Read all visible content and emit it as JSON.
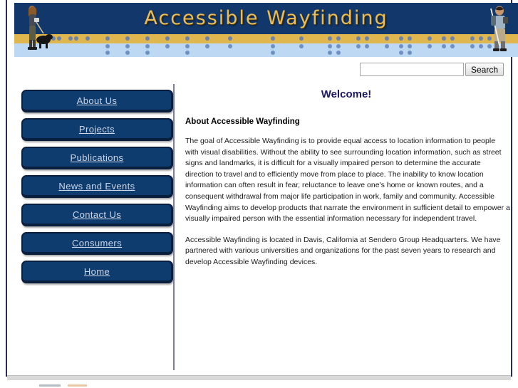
{
  "site": {
    "title": "Accessible Wayfinding"
  },
  "banner": {
    "title": "Accessible Wayfinding",
    "colors": {
      "navy": "#12386b",
      "gold": "#e0b64e",
      "sky": "#bcd8f2",
      "title_text": "#e8bd5c"
    },
    "images": [
      {
        "name": "woman-with-guide-dog-photo",
        "position": "left"
      },
      {
        "name": "man-with-white-cane-photo",
        "position": "right"
      }
    ]
  },
  "search": {
    "value": "",
    "placeholder": "",
    "button_label": "Search"
  },
  "sidebar": {
    "items": [
      {
        "label": "About Us"
      },
      {
        "label": "Projects"
      },
      {
        "label": "Publications"
      },
      {
        "label": "News and Events"
      },
      {
        "label": "Contact Us"
      },
      {
        "label": "Consumers"
      },
      {
        "label": "Home"
      }
    ]
  },
  "main": {
    "welcome_heading": "Welcome!",
    "about_heading": "About Accessible Wayfinding",
    "paragraph_1": "The goal of Accessible Wayfinding is to provide equal access to location information to people with visual disabilities. Without the ability to see surrounding location information, such as street signs and landmarks, it is difficult for a visually impaired person to determine the accurate direction to travel and to efficiently move from place to place. The inability to know location information can often result in fear, reluctance to leave one's home or known routes, and a consequent withdrawal from major life participation in work, family and community. Accessible Wayfinding aims to develop products that narrate the environment in sufficient detail to empower a visually impaired person with the essential information necessary for independent travel.",
    "paragraph_2": "Accessible Wayfinding is located in Davis, California at Sendero Group Headquarters. We have partnered with various universities and organizations for the past seven years to research and develop Accessible Wayfinding devices."
  },
  "theme": {
    "heading_color": "#1a1a60",
    "button_fill": "#0f3c6e",
    "button_border": "#0a1f3d",
    "button_text": "#ccd6e8",
    "divider_color": "#7d7da0",
    "frame_border": "#2b2b55"
  }
}
